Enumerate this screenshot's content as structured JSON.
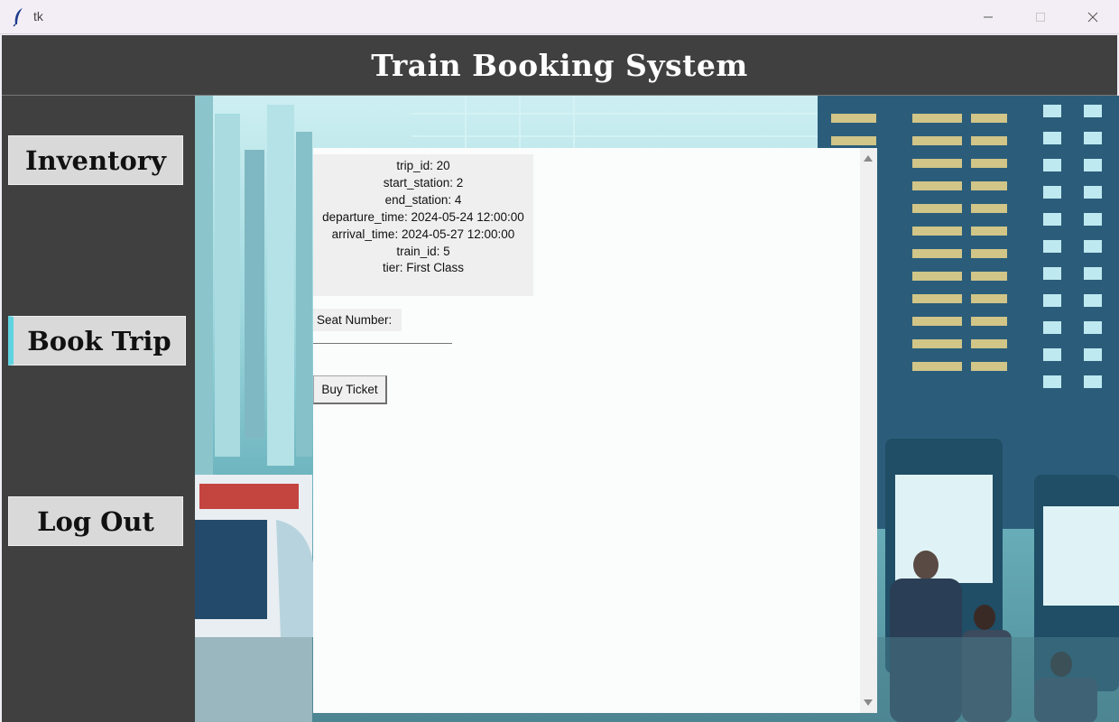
{
  "window": {
    "title": "tk",
    "controls": [
      "minimize",
      "maximize",
      "close"
    ]
  },
  "header": {
    "title": "Train Booking System"
  },
  "sidebar": {
    "items": [
      {
        "label": "Inventory",
        "active": false
      },
      {
        "label": "Book Trip",
        "active": true
      },
      {
        "label": "Log Out",
        "active": false
      }
    ]
  },
  "trip": {
    "lines": [
      "trip_id: 20",
      "start_station: 2",
      "end_station: 4",
      "departure_time: 2024-05-24 12:00:00",
      "arrival_time: 2024-05-27 12:00:00",
      "train_id: 5",
      "tier: First Class"
    ]
  },
  "form": {
    "seat_label": "Seat Number:",
    "seat_value": "",
    "buy_label": "Buy Ticket"
  },
  "colors": {
    "header_bg": "#404040",
    "button_bg": "#d9d9d9",
    "active_accent": "#5fd3e0"
  }
}
